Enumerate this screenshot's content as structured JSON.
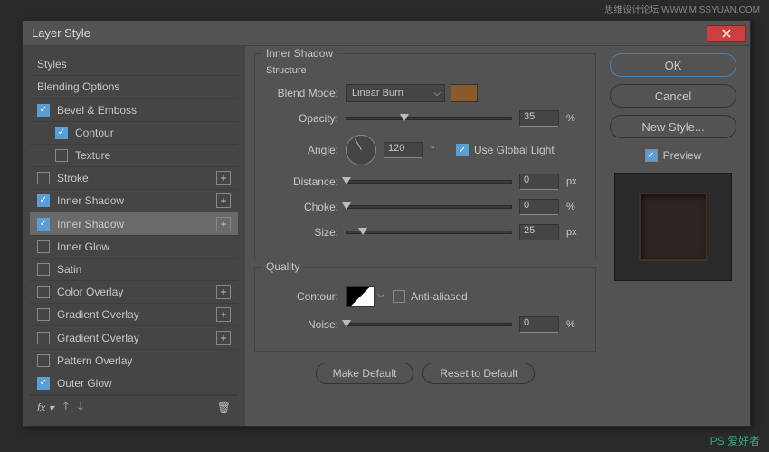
{
  "watermark_top": "思维设计论坛 WWW.MISSYUAN.COM",
  "watermark_bottom": "PS 爱好者",
  "title": "Layer Style",
  "sidebar": {
    "items": [
      {
        "label": "Styles"
      },
      {
        "label": "Blending Options"
      },
      {
        "label": "Bevel & Emboss",
        "checked": true
      },
      {
        "label": "Contour",
        "checked": true,
        "sub": true
      },
      {
        "label": "Texture",
        "checked": false,
        "sub": true
      },
      {
        "label": "Stroke",
        "checked": false,
        "plus": true
      },
      {
        "label": "Inner Shadow",
        "checked": true,
        "plus": true
      },
      {
        "label": "Inner Shadow",
        "checked": true,
        "plus": true,
        "selected": true
      },
      {
        "label": "Inner Glow",
        "checked": false
      },
      {
        "label": "Satin",
        "checked": false
      },
      {
        "label": "Color Overlay",
        "checked": false,
        "plus": true
      },
      {
        "label": "Gradient Overlay",
        "checked": false,
        "plus": true
      },
      {
        "label": "Gradient Overlay",
        "checked": false,
        "plus": true
      },
      {
        "label": "Pattern Overlay",
        "checked": false
      },
      {
        "label": "Outer Glow",
        "checked": true
      }
    ],
    "footer": {
      "fx": "fx",
      "up": "↑",
      "down": "↓",
      "trash": "🗑"
    }
  },
  "structure": {
    "title": "Inner Shadow",
    "subtitle": "Structure",
    "blend_mode_label": "Blend Mode:",
    "blend_mode_value": "Linear Burn",
    "color_swatch": "#8a5a2a",
    "opacity_label": "Opacity:",
    "opacity_value": "35",
    "opacity_unit": "%",
    "angle_label": "Angle:",
    "angle_value": "120",
    "angle_unit": "°",
    "global_light_label": "Use Global Light",
    "global_light_checked": true,
    "distance_label": "Distance:",
    "distance_value": "0",
    "distance_unit": "px",
    "choke_label": "Choke:",
    "choke_value": "0",
    "choke_unit": "%",
    "size_label": "Size:",
    "size_value": "25",
    "size_unit": "px"
  },
  "quality": {
    "title": "Quality",
    "contour_label": "Contour:",
    "antialiased_label": "Anti-aliased",
    "antialiased_checked": false,
    "noise_label": "Noise:",
    "noise_value": "0",
    "noise_unit": "%"
  },
  "buttons": {
    "make_default": "Make Default",
    "reset_default": "Reset to Default"
  },
  "right": {
    "ok": "OK",
    "cancel": "Cancel",
    "new_style": "New Style...",
    "preview": "Preview",
    "preview_checked": true
  }
}
